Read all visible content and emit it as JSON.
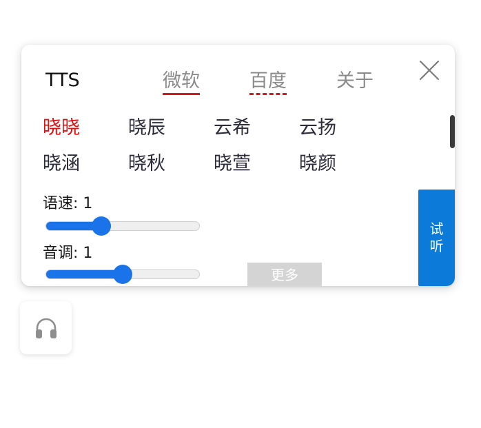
{
  "panel": {
    "title": "TTS",
    "tabs": [
      {
        "label": "微软",
        "underline": "solid",
        "color": "#d11a1a"
      },
      {
        "label": "百度",
        "underline": "dashed",
        "color": "#d11a1a"
      },
      {
        "label": "关于"
      }
    ],
    "close_icon": "close-icon",
    "voices": [
      {
        "label": "晓晓",
        "active": true
      },
      {
        "label": "晓辰",
        "active": false
      },
      {
        "label": "云希",
        "active": false
      },
      {
        "label": "云扬",
        "active": false
      },
      {
        "label": "晓涵",
        "active": false
      },
      {
        "label": "晓秋",
        "active": false
      },
      {
        "label": "晓萱",
        "active": false
      },
      {
        "label": "晓颜",
        "active": false
      }
    ],
    "speed": {
      "label": "语速: 1",
      "level_fraction": 0.36
    },
    "pitch": {
      "label": "音调: 1",
      "level_fraction": 0.5
    },
    "more_label": "更多",
    "try_label": "试听"
  },
  "launcher": {
    "icon": "headset-icon"
  },
  "colors": {
    "accent": "#1a73e8",
    "active_voice": "#e01010",
    "tab_underline": "#d11a1a",
    "try_button": "#0b7ad8",
    "more_button": "#d4d4d4"
  }
}
